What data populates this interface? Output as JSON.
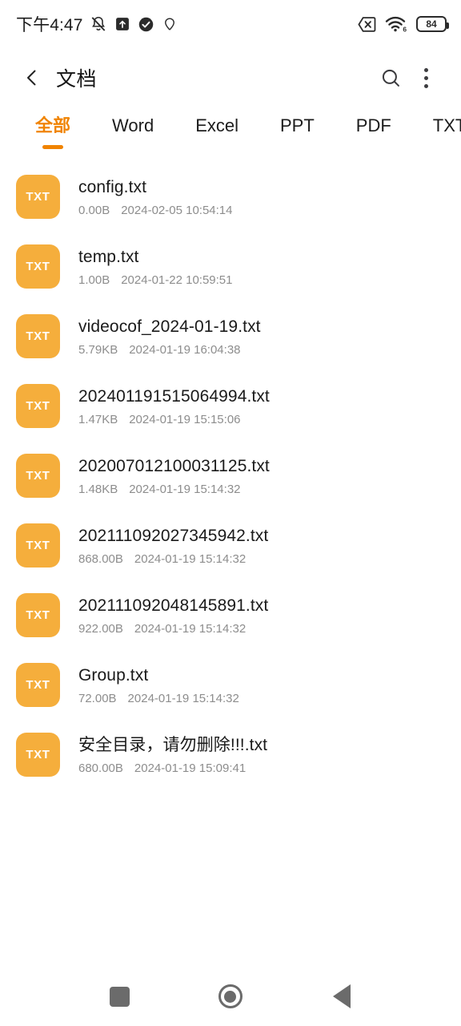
{
  "status_bar": {
    "time": "下午4:47",
    "left_icons": [
      "silent-bell-icon",
      "upload-box-icon",
      "check-circle-icon",
      "location-pin-icon"
    ],
    "right_icons": [
      "no-sim-icon",
      "wifi-6-icon"
    ],
    "wifi_label": "6",
    "battery_percent": "84"
  },
  "header": {
    "back_icon": "chevron-left-icon",
    "title": "文档",
    "search_icon": "search-icon",
    "overflow_icon": "more-vertical-icon"
  },
  "tabs": [
    {
      "label": "全部",
      "active": true
    },
    {
      "label": "Word",
      "active": false
    },
    {
      "label": "Excel",
      "active": false
    },
    {
      "label": "PPT",
      "active": false
    },
    {
      "label": "PDF",
      "active": false
    },
    {
      "label": "TXT",
      "active": false
    }
  ],
  "files": [
    {
      "badge": "TXT",
      "name": "config.txt",
      "size": "0.00B",
      "date": "2024-02-05 10:54:14"
    },
    {
      "badge": "TXT",
      "name": "temp.txt",
      "size": "1.00B",
      "date": "2024-01-22 10:59:51"
    },
    {
      "badge": "TXT",
      "name": "videocof_2024-01-19.txt",
      "size": "5.79KB",
      "date": "2024-01-19 16:04:38"
    },
    {
      "badge": "TXT",
      "name": "202401191515064994.txt",
      "size": "1.47KB",
      "date": "2024-01-19 15:15:06"
    },
    {
      "badge": "TXT",
      "name": "202007012100031125.txt",
      "size": "1.48KB",
      "date": "2024-01-19 15:14:32"
    },
    {
      "badge": "TXT",
      "name": "202111092027345942.txt",
      "size": "868.00B",
      "date": "2024-01-19 15:14:32"
    },
    {
      "badge": "TXT",
      "name": "202111092048145891.txt",
      "size": "922.00B",
      "date": "2024-01-19 15:14:32"
    },
    {
      "badge": "TXT",
      "name": "Group.txt",
      "size": "72.00B",
      "date": "2024-01-19 15:14:32"
    },
    {
      "badge": "TXT",
      "name": "安全目录，请勿删除!!!.txt",
      "size": "680.00B",
      "date": "2024-01-19 15:09:41"
    }
  ],
  "nav_bar": {
    "recents_icon": "square-recents-icon",
    "home_icon": "circle-home-icon",
    "back_icon": "triangle-back-icon"
  },
  "colors": {
    "accent": "#F08300",
    "file_badge": "#F5AE3C",
    "text_primary": "#1a1a1a",
    "text_secondary": "#8d8d8d",
    "nav_icon": "#6b6b6b",
    "background": "#ffffff"
  }
}
